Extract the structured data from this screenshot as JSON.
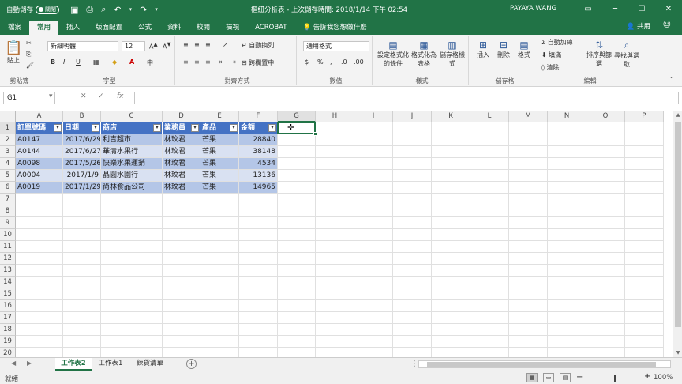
{
  "titlebar": {
    "autosave_label": "自動儲存",
    "autosave_state": "關閉",
    "document_title": "樞紐分析表 - 上次儲存時間: 2018/1/14 下午 02:54",
    "user_name": "PAYAYA WANG"
  },
  "tabs": [
    "檔案",
    "常用",
    "插入",
    "版面配置",
    "公式",
    "資料",
    "校閱",
    "檢視",
    "ACROBAT"
  ],
  "active_tab": "常用",
  "tell_me": "告訴我您想做什麼",
  "share_label": "共用",
  "ribbon": {
    "clipboard": {
      "paste": "貼上",
      "label": "剪貼簿"
    },
    "font": {
      "name": "新細明體",
      "size": "12",
      "label": "字型"
    },
    "alignment": {
      "wrap": "自動換列",
      "merge": "跨欄置中",
      "label": "對齊方式"
    },
    "number": {
      "format": "通用格式",
      "label": "數值"
    },
    "styles": {
      "conditional": "設定格式化的條件",
      "as_table": "格式化為表格",
      "cell_styles": "儲存格樣式",
      "label": "樣式"
    },
    "cells": {
      "insert": "插入",
      "delete": "刪除",
      "format": "格式",
      "label": "儲存格"
    },
    "editing": {
      "autosum": "自動加總",
      "fill": "填滿",
      "clear": "清除",
      "sort": "排序與篩選",
      "find": "尋找與選取",
      "label": "編輯"
    }
  },
  "name_box": "G1",
  "formula_value": "",
  "columns": [
    "A",
    "B",
    "C",
    "D",
    "E",
    "F",
    "G",
    "H",
    "I",
    "J",
    "K",
    "L",
    "M",
    "N",
    "O",
    "P"
  ],
  "selected_column": "G",
  "selected_row": "1",
  "row_numbers": [
    "1",
    "2",
    "3",
    "4",
    "5",
    "6",
    "7",
    "8",
    "9",
    "10",
    "11",
    "12",
    "13",
    "14",
    "15",
    "16",
    "17",
    "18",
    "19",
    "20"
  ],
  "table": {
    "headers": [
      "訂單號碼",
      "日期",
      "商店",
      "業務員",
      "產品",
      "金額"
    ],
    "rows": [
      [
        "A0147",
        "2017/6/29",
        "利吉超市",
        "林玟君",
        "芒果",
        "28840"
      ],
      [
        "A0144",
        "2017/6/27",
        "華清水果行",
        "林玟君",
        "芒果",
        "38148"
      ],
      [
        "A0098",
        "2017/5/26",
        "快樂水果運銷",
        "林玟君",
        "芒果",
        "4534"
      ],
      [
        "A0004",
        "2017/1/9",
        "晶圓水園行",
        "林玟君",
        "芒果",
        "13136"
      ],
      [
        "A0019",
        "2017/1/29",
        "尚林食品公司",
        "林玟君",
        "芒果",
        "14965"
      ]
    ],
    "colors": {
      "header": "#4472c4",
      "band_dark": "#b4c6e7",
      "band_light": "#d9e1f2"
    }
  },
  "sheets": [
    "工作表2",
    "工作表1",
    "鍊貨清單"
  ],
  "active_sheet": "工作表2",
  "status": "就緒",
  "zoom": "100%",
  "accent_color": "#217346"
}
